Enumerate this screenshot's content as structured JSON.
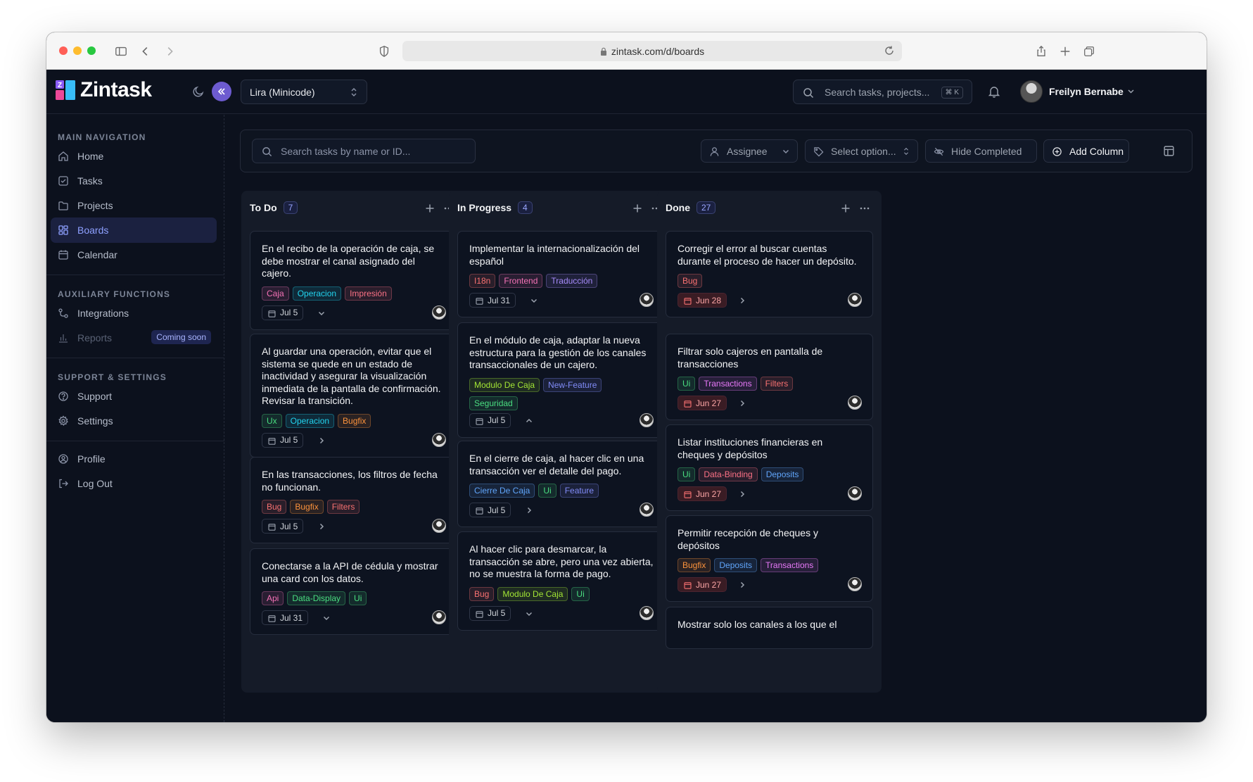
{
  "browser": {
    "url": "zintask.com/d/boards"
  },
  "app": {
    "name": "Zintask",
    "workspace": "Lira (Minicode)",
    "search_placeholder": "Search tasks, projects...",
    "search_shortcut": "⌘ K",
    "user_name": "Freilyn Bernabe"
  },
  "sidebar": {
    "main_heading": "MAIN NAVIGATION",
    "main_items": [
      {
        "label": "Home",
        "icon": "home-icon"
      },
      {
        "label": "Tasks",
        "icon": "checkbox-icon"
      },
      {
        "label": "Projects",
        "icon": "folder-icon"
      },
      {
        "label": "Boards",
        "icon": "grid-icon",
        "active": true
      },
      {
        "label": "Calendar",
        "icon": "calendar-icon"
      }
    ],
    "aux_heading": "AUXILIARY FUNCTIONS",
    "aux_items": [
      {
        "label": "Integrations",
        "icon": "integrations-icon"
      },
      {
        "label": "Reports",
        "icon": "chart-icon",
        "badge": "Coming soon",
        "disabled": true
      }
    ],
    "support_heading": "SUPPORT & SETTINGS",
    "support_items": [
      {
        "label": "Support",
        "icon": "help-icon"
      },
      {
        "label": "Settings",
        "icon": "gear-icon"
      }
    ],
    "account_items": [
      {
        "label": "Profile",
        "icon": "user-circle-icon"
      },
      {
        "label": "Log Out",
        "icon": "logout-icon"
      }
    ]
  },
  "toolbar": {
    "search_placeholder": "Search tasks by name or ID...",
    "assignee": "Assignee",
    "select_option": "Select option...",
    "hide_completed": "Hide Completed",
    "add_column": "Add Column"
  },
  "columns": [
    {
      "title": "To Do",
      "count": "7",
      "cards": [
        {
          "title": "En el recibo de la operación de caja, se debe mostrar el canal asignado del cajero.",
          "tags": [
            "Caja",
            "Operacion",
            "Impresión"
          ],
          "date": "Jul 5",
          "expand": "chevron-down"
        },
        {
          "title": "Al guardar una operación, evitar que el sistema se quede en un estado de inactividad y asegurar la visualización inmediata de la pantalla de confirmación. Revisar la transición.",
          "tags": [
            "Ux",
            "Operacion",
            "Bugfix"
          ],
          "date": "Jul 5",
          "expand": "chevron-right"
        },
        {
          "title": "En las transacciones, los filtros de fecha no funcionan.",
          "tags": [
            "Bug",
            "Bugfix",
            "Filters"
          ],
          "date": "Jul 5",
          "expand": "chevron-right"
        },
        {
          "title": "Conectarse a la API de cédula y mostrar una card con los datos.",
          "tags": [
            "Api",
            "Data-Display",
            "Ui"
          ],
          "date": "Jul 31",
          "expand": "chevron-down"
        }
      ]
    },
    {
      "title": "In Progress",
      "count": "4",
      "cards": [
        {
          "title": "Implementar la internacionalización del español",
          "tags": [
            "I18n",
            "Frontend",
            "Traducción"
          ],
          "date": "Jul 31",
          "expand": "chevron-down"
        },
        {
          "title": "En el módulo de caja, adaptar la nueva estructura para la gestión de los canales transaccionales de un cajero.",
          "tags": [
            "Modulo De Caja",
            "New-Feature",
            "Seguridad"
          ],
          "date": "Jul 5",
          "expand": "chevron-up"
        },
        {
          "title": "En el cierre de caja, al hacer clic en una transacción ver el detalle del pago.",
          "tags": [
            "Cierre De Caja",
            "Ui",
            "Feature"
          ],
          "date": "Jul 5",
          "expand": "chevron-right"
        },
        {
          "title": "Al hacer clic para desmarcar, la transacción se abre, pero una vez abierta, no se muestra la forma de pago.",
          "tags": [
            "Bug",
            "Modulo De Caja",
            "Ui"
          ],
          "date": "Jul 5",
          "expand": "chevron-down"
        }
      ]
    },
    {
      "title": "Done",
      "count": "27",
      "cards": [
        {
          "title": "Corregir el error al buscar cuentas durante el proceso de hacer un depósito.",
          "tags": [
            "Bug"
          ],
          "date": "Jun 28",
          "expand": "chevron-right",
          "overdue": true
        },
        {
          "title": "Filtrar solo cajeros en pantalla de transacciones",
          "tags": [
            "Ui",
            "Transactions",
            "Filters"
          ],
          "date": "Jun 27",
          "expand": "chevron-right",
          "overdue": true
        },
        {
          "title": "Listar instituciones financieras en cheques y depósitos",
          "tags": [
            "Ui",
            "Data-Binding",
            "Deposits"
          ],
          "date": "Jun 27",
          "expand": "chevron-right",
          "overdue": true
        },
        {
          "title": "Permitir recepción de cheques y depósitos",
          "tags": [
            "Bugfix",
            "Deposits",
            "Transactions"
          ],
          "date": "Jun 27",
          "expand": "chevron-right",
          "overdue": true
        },
        {
          "title": "Mostrar solo los canales a los que el",
          "tags": [],
          "date": "",
          "expand": ""
        }
      ]
    }
  ],
  "tag_colors": {
    "Caja": "#f472b6",
    "Operacion": "#22d3ee",
    "Impresión": "#fb7185",
    "Ux": "#4ade80",
    "Bugfix": "#fb923c",
    "Bug": "#f87171",
    "Filters": "#f87171",
    "Api": "#f472b6",
    "Data-Display": "#4ade80",
    "Ui": "#4ade80",
    "I18n": "#f87171",
    "Frontend": "#f472b6",
    "Traducción": "#a78bfa",
    "Modulo De Caja": "#a3e635",
    "New-Feature": "#818cf8",
    "Seguridad": "#4ade80",
    "Cierre De Caja": "#60a5fa",
    "Feature": "#818cf8",
    "Transactions": "#e879f9",
    "Data-Binding": "#fb7185",
    "Deposits": "#60a5fa"
  }
}
